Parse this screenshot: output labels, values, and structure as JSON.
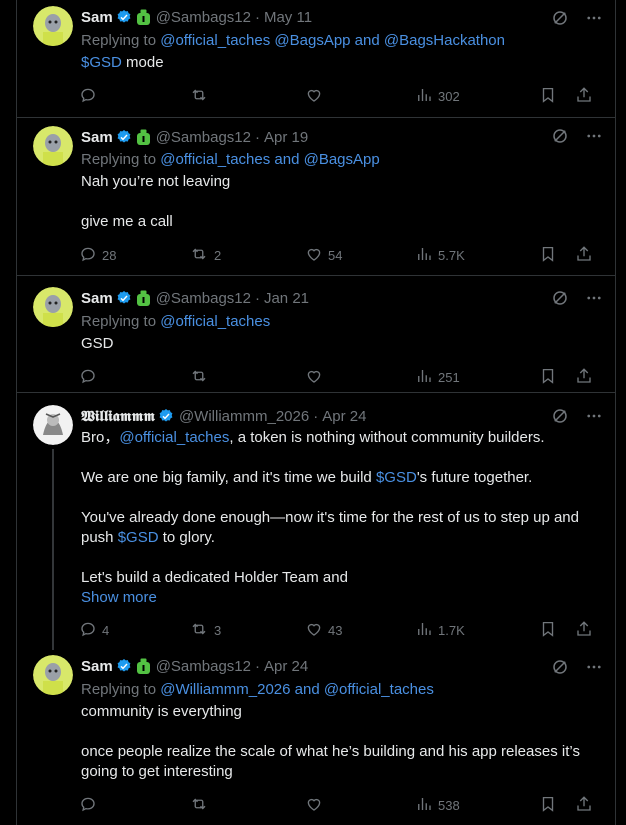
{
  "tweets": [
    {
      "name": "Sam",
      "handle": "@Sambags12",
      "date": "May 11",
      "reply_prefix": "Replying to",
      "reply_to": "@official_taches @BagsApp and @BagsHackathon",
      "lines": [
        [
          "$GSD",
          " mode"
        ]
      ],
      "replies": "",
      "retweets": "",
      "likes": "",
      "views": "302"
    },
    {
      "name": "Sam",
      "handle": "@Sambags12",
      "date": "Apr 19",
      "reply_prefix": "Replying to",
      "reply_to": "@official_taches and @BagsApp",
      "lines": [
        "Nah you’re not leaving",
        "",
        "give me a call"
      ],
      "replies": "28",
      "retweets": "2",
      "likes": "54",
      "views": "5.7K"
    },
    {
      "name": "Sam",
      "handle": "@Sambags12",
      "date": "Jan 21",
      "reply_prefix": "Replying to",
      "reply_to": "@official_taches",
      "lines": [
        "GSD"
      ],
      "replies": "",
      "retweets": "",
      "likes": "",
      "views": "251"
    },
    {
      "name": "𝖂𝖎𝖑𝖑𝖎𝖆𝖒𝖒𝖒",
      "handle": "@Williammm_2026",
      "date": "Apr 24",
      "line1_a": "Bro，",
      "line1_mention": "@official_taches",
      "line1_b": ", a token is nothing without community builders.",
      "line2_a": "We are one big family, and it's time we build ",
      "line2_tag": "$GSD",
      "line2_b": "'s future together.",
      "line3": "You've already done enough—now it's time for the rest of us to step up and",
      "line4_a": "push ",
      "line4_tag": "$GSD",
      "line4_b": " to glory.",
      "line5": "Let's build a dedicated Holder Team and",
      "show_more": "Show more",
      "replies": "4",
      "retweets": "3",
      "likes": "43",
      "views": "1.7K"
    },
    {
      "name": "Sam",
      "handle": "@Sambags12",
      "date": "Apr 24",
      "reply_prefix": "Replying to",
      "reply_to": "@Williammm_2026 and @official_taches",
      "lines": [
        "community is everything",
        "",
        "once people realize the scale of what he’s building and his app releases it’s",
        "going to get interesting"
      ],
      "replies": "",
      "retweets": "",
      "likes": "",
      "views": "538"
    }
  ],
  "colors": {
    "accent": "#1d9bf0",
    "link": "#4a90e2",
    "muted": "#71767b",
    "border": "#2f3336",
    "bag": "#53c243"
  },
  "icons": [
    "verified-icon",
    "money-bag-icon",
    "grok-icon",
    "more-icon",
    "reply-icon",
    "retweet-icon",
    "like-icon",
    "views-icon",
    "bookmark-icon",
    "share-icon"
  ]
}
